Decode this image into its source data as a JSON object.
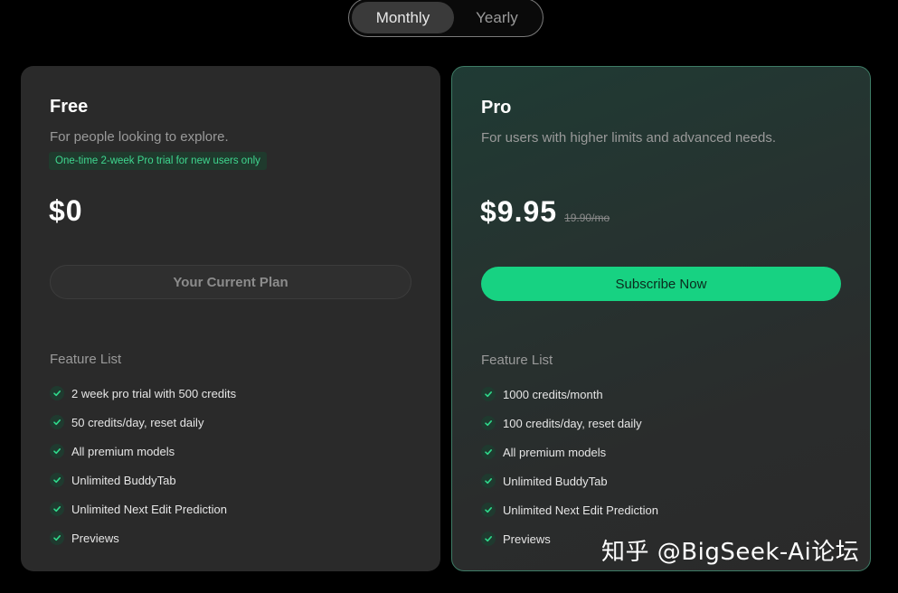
{
  "billing_toggle": {
    "monthly_label": "Monthly",
    "yearly_label": "Yearly",
    "selected": "Monthly"
  },
  "plans": [
    {
      "name": "Free",
      "description": "For people looking to explore.",
      "badge": "One-time 2-week Pro trial for new users only",
      "price": "$0",
      "button_label": "Your Current Plan",
      "feature_title": "Feature List",
      "features": [
        "2 week pro trial with 500 credits",
        "50 credits/day, reset daily",
        "All premium models",
        "Unlimited BuddyTab",
        "Unlimited Next Edit Prediction",
        "Previews"
      ]
    },
    {
      "name": "Pro",
      "description": "For users with higher limits and advanced needs.",
      "price": "$9.95",
      "old_price": "19.90/mo",
      "button_label": "Subscribe Now",
      "feature_title": "Feature List",
      "features": [
        "1000 credits/month",
        "100 credits/day, reset daily",
        "All premium models",
        "Unlimited BuddyTab",
        "Unlimited Next Edit Prediction",
        "Previews"
      ]
    }
  ],
  "watermark": "知乎 @BigSeek-Ai论坛",
  "colors": {
    "accent": "#17d282",
    "background": "#000000",
    "card": "#2a2a2a",
    "badge_text": "#3fd68f"
  },
  "icons": {
    "feature": "check-icon"
  }
}
